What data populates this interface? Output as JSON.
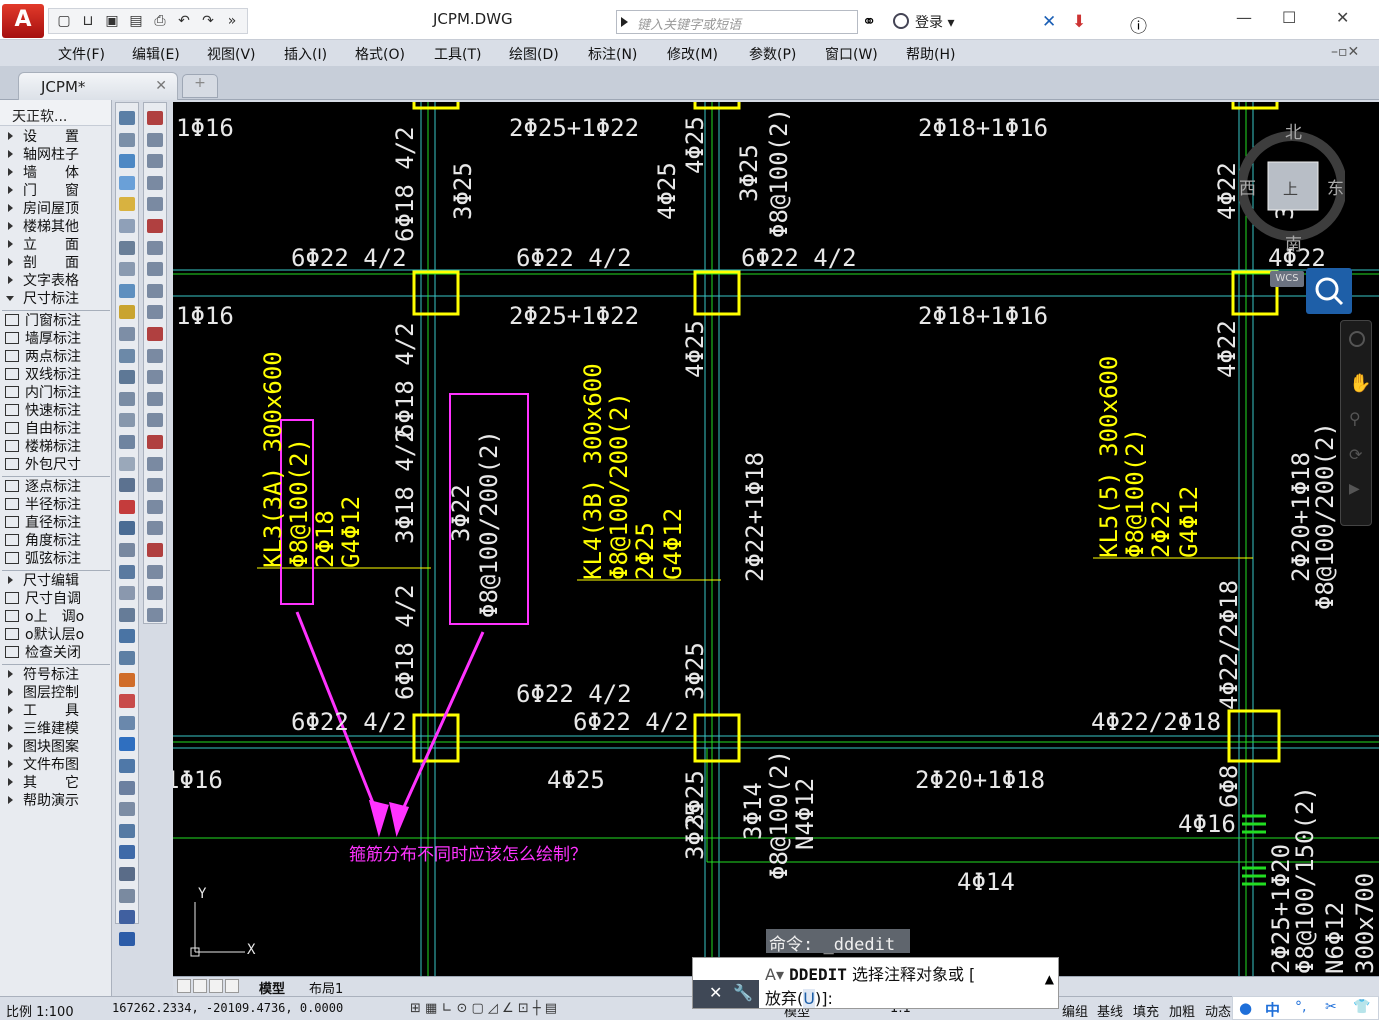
{
  "app": {
    "logo": "A",
    "doc_title": "JCPM.DWG"
  },
  "qat": {
    "icons": [
      "new-icon",
      "open-icon",
      "save-icon",
      "saveas-icon",
      "print-icon",
      "undo-icon",
      "redo-icon",
      "more-icon"
    ]
  },
  "search": {
    "placeholder": "键入关键字或短语"
  },
  "login": {
    "label": "登录"
  },
  "menu": [
    "文件(F)",
    "编辑(E)",
    "视图(V)",
    "插入(I)",
    "格式(O)",
    "工具(T)",
    "绘图(D)",
    "标注(N)",
    "修改(M)",
    "参数(P)",
    "窗口(W)",
    "帮助(H)"
  ],
  "tab": {
    "label": "JCPM*"
  },
  "panel": {
    "title": "天正软...",
    "groups": [
      {
        "type": "expand",
        "label": "设　　置"
      },
      {
        "type": "expand",
        "label": "轴网柱子"
      },
      {
        "type": "expand",
        "label": "墙　　体"
      },
      {
        "type": "expand",
        "label": "门　　窗"
      },
      {
        "type": "expand",
        "label": "房间屋顶"
      },
      {
        "type": "expand",
        "label": "楼梯其他"
      },
      {
        "type": "expand",
        "label": "立　　面"
      },
      {
        "type": "expand",
        "label": "剖　　面"
      },
      {
        "type": "expand",
        "label": "文字表格"
      },
      {
        "type": "open",
        "label": "尺寸标注"
      },
      {
        "type": "sep"
      },
      {
        "type": "cmd",
        "label": "门窗标注"
      },
      {
        "type": "cmd",
        "label": "墙厚标注"
      },
      {
        "type": "cmd",
        "label": "两点标注"
      },
      {
        "type": "cmd",
        "label": "双线标注"
      },
      {
        "type": "cmd",
        "label": "内门标注"
      },
      {
        "type": "cmd",
        "label": "快速标注"
      },
      {
        "type": "cmd",
        "label": "自由标注"
      },
      {
        "type": "cmd",
        "label": "楼梯标注"
      },
      {
        "type": "cmd",
        "label": "外包尺寸"
      },
      {
        "type": "sep"
      },
      {
        "type": "cmd",
        "label": "逐点标注"
      },
      {
        "type": "cmd",
        "label": "半径标注"
      },
      {
        "type": "cmd",
        "label": "直径标注"
      },
      {
        "type": "cmd",
        "label": "角度标注"
      },
      {
        "type": "cmd",
        "label": "弧弦标注"
      },
      {
        "type": "sep"
      },
      {
        "type": "expand",
        "label": "尺寸编辑"
      },
      {
        "type": "cmd",
        "label": "尺寸自调"
      },
      {
        "type": "cmd",
        "label": "o上　调o"
      },
      {
        "type": "cmd",
        "label": "o默认层o"
      },
      {
        "type": "cmd",
        "label": "检查关闭"
      },
      {
        "type": "sep"
      },
      {
        "type": "expand",
        "label": "符号标注"
      },
      {
        "type": "expand",
        "label": "图层控制"
      },
      {
        "type": "expand",
        "label": "工　　具"
      },
      {
        "type": "expand",
        "label": "三维建模"
      },
      {
        "type": "expand",
        "label": "图块图案"
      },
      {
        "type": "expand",
        "label": "文件布图"
      },
      {
        "type": "expand",
        "label": "其　　它"
      },
      {
        "type": "expand",
        "label": "帮助演示"
      }
    ]
  },
  "drawing": {
    "texts": {
      "t1": "1Φ16",
      "t2": "2Φ25+1Φ22",
      "t3": "2Φ18+1Φ16",
      "t4": "1Φ16",
      "t5": "2Φ25+1Φ22",
      "t6": "2Φ18+1Φ16",
      "t7": "6Φ22 4/2",
      "t8": "6Φ22 4/2",
      "t9": "6Φ22 4/2",
      "t10": "4Φ22",
      "v1": "6Φ18 4/2",
      "v2": "3Φ25",
      "v3": "4Φ25",
      "v4": "4Φ25",
      "v5": "3Φ25",
      "v6": "Φ8@100(2)",
      "v7": "4Φ22",
      "v8": "3Φ25",
      "v9": "6Φ18 4/2",
      "v10": "3Φ18 4/2",
      "v11": "4Φ25",
      "v12": "4Φ22",
      "kl3": "KL3(3A) 300x600",
      "kl3b": "Φ8@100(2)",
      "kl3c": "2Φ18",
      "kl3d": "G4Φ12",
      "mid1": "3Φ22",
      "mid2": "Φ8@100/200(2)",
      "kl4": "KL4(3B) 300x600",
      "kl4b": "Φ8@100/200(2)",
      "kl4c": "2Φ25",
      "kl4d": "G4Φ12",
      "v13": "2Φ22+1Φ18",
      "kl5": "KL5(5) 300x600",
      "kl5b": "Φ8@100(2)",
      "kl5c": "2Φ22",
      "kl5d": "G4Φ12",
      "v14": "2Φ20+1Φ18",
      "v15": "Φ8@100/200(2)",
      "v16": "4Φ22/2Φ18",
      "v17": "6Φ18 4/2",
      "v18": "3Φ25",
      "t11": "6Φ22 4/2",
      "t12": "6Φ22 4/2",
      "t13": "6Φ22 4/2",
      "t14": "4Φ22/2Φ18",
      "t15": "1Φ16",
      "t16": "4Φ25",
      "t17": "2Φ20+1Φ18",
      "t18": "4Φ16",
      "t19": "4Φ14",
      "v19": "3Φ25",
      "v20": "3Φ25",
      "v21": "3Φ14",
      "v22": "Φ8@100(2)",
      "v23": "N4Φ12",
      "v24": "6Φ8",
      "v25": "2Φ25+1Φ20",
      "v26": "Φ8@100/150(2)",
      "v27": "N6Φ12",
      "v28": "300x700",
      "question": "箍筋分布不同时应该怎么绘制？",
      "ucs_x": "X",
      "ucs_y": "Y"
    }
  },
  "viewcube": {
    "north": "北",
    "south": "南",
    "east": "东",
    "west": "西",
    "top": "上",
    "wcs": "WCS"
  },
  "command": {
    "history": "命令: _ddedit",
    "prompt_cmd": "DDEDIT",
    "prompt_text": "选择注释对象或 [",
    "prompt_line2_a": "放弃(",
    "prompt_key": "U",
    "prompt_line2_b": ")]:"
  },
  "layout": {
    "tabs": [
      "模型",
      "布局1"
    ]
  },
  "status": {
    "scale": "比例 1:100",
    "coords": "167262.2334,  -20109.4736,  0.0000",
    "model": "模型",
    "scale2": "1:1",
    "items": [
      "编组",
      "基线",
      "填充",
      "加粗",
      "动态"
    ]
  },
  "ime": {
    "lang": "中"
  },
  "colors": {
    "yellow": "#ffff00",
    "cyan": "#38c6c6",
    "green": "#22dd22",
    "magenta": "#ff33ff",
    "white": "#e8e8e8"
  }
}
